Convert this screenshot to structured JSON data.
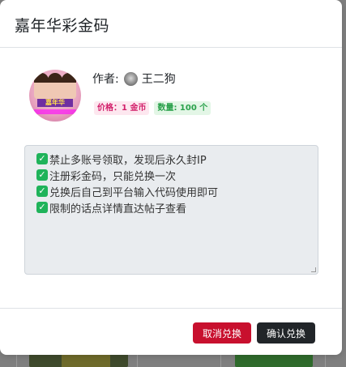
{
  "modal": {
    "title": "嘉年华彩金码",
    "author_label": "作者:",
    "author_name": "王二狗",
    "avatar_banner": "嘉年华",
    "price_badge": "价格：1 金币",
    "quantity_badge": "数量: 100 个",
    "rules": [
      "禁止多账号领取，发现后永久封IP",
      "注册彩金码，只能兑换一次",
      "兑换后自己到平台输入代码使用即可",
      "限制的话点详情直达帖子查看"
    ],
    "cancel_label": "取消兑换",
    "confirm_label": "确认兑换"
  },
  "colors": {
    "cancel": "#c8102e",
    "confirm": "#212529",
    "check": "#1fb35a",
    "price": "#d21e6a",
    "quantity": "#2aa14b"
  }
}
